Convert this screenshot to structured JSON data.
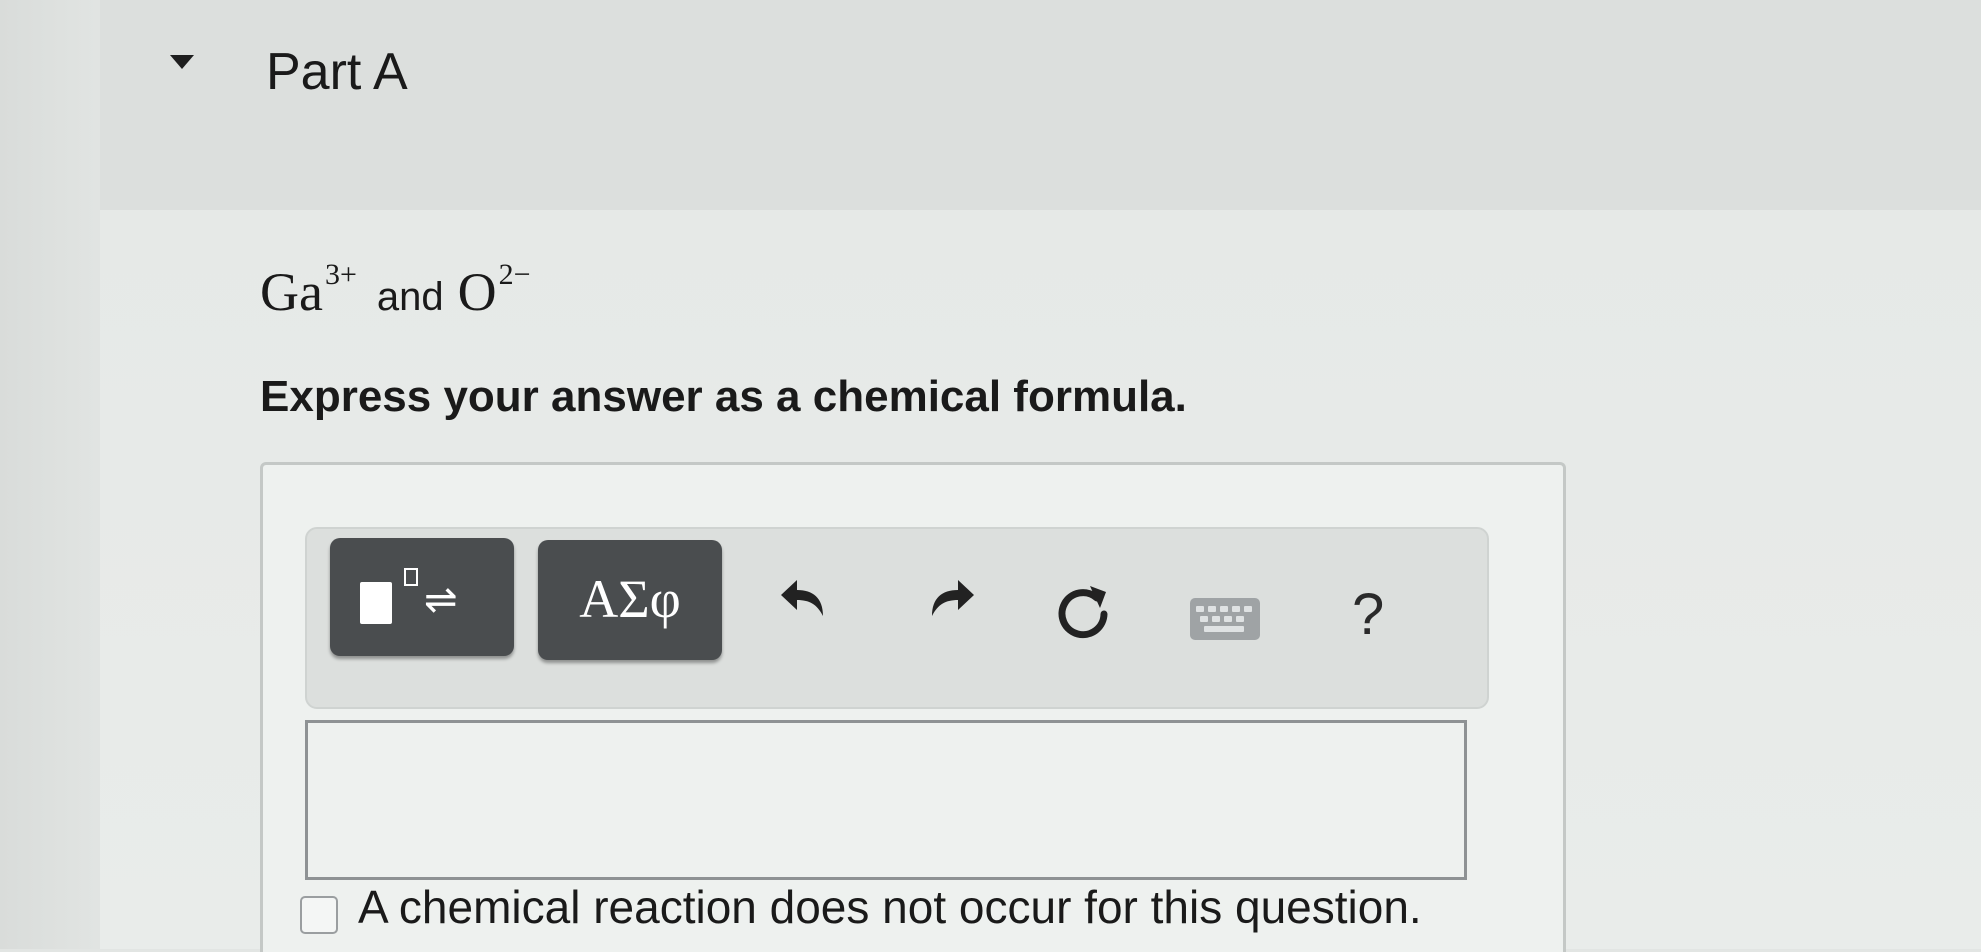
{
  "part": {
    "title": "Part A"
  },
  "question": {
    "ion1": "Ga",
    "ion1_charge": "3+",
    "conjunction": "and",
    "ion2": "O",
    "ion2_charge": "2−"
  },
  "instruction": "Express your answer as a chemical formula.",
  "toolbar": {
    "symbols_label": "ΑΣφ",
    "help_label": "?",
    "icons": [
      "templates-icon",
      "undo-icon",
      "redo-icon",
      "reset-icon",
      "keyboard-icon",
      "help-icon"
    ]
  },
  "answer": {
    "value": ""
  },
  "no_reaction": {
    "label": "A chemical reaction does not occur for this question.",
    "checked": false
  }
}
